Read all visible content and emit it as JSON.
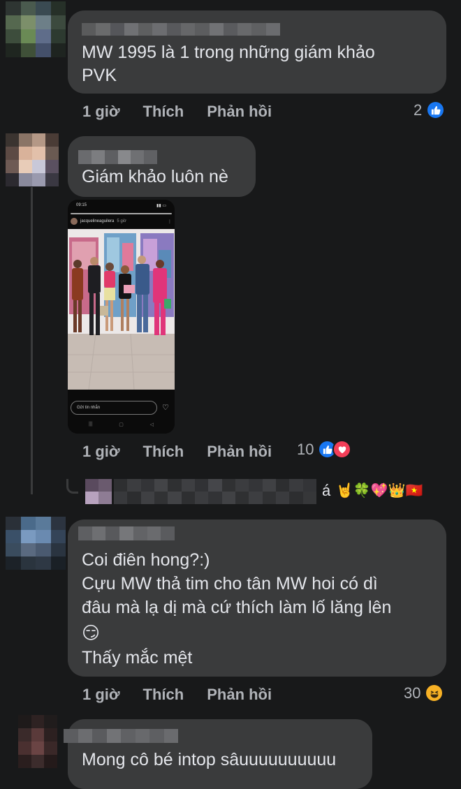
{
  "comments": [
    {
      "text_lines": [
        "MW 1995 là 1 trong những giám khảo",
        "PVK"
      ],
      "time": "1 giờ",
      "like_label": "Thích",
      "reply_label": "Phản hồi",
      "reaction_count": "2",
      "reactions": [
        "like"
      ]
    },
    {
      "text_lines": [
        "Giám khảo luôn nè"
      ],
      "time": "1 giờ",
      "like_label": "Thích",
      "reply_label": "Phản hồi",
      "reaction_count": "10",
      "reactions": [
        "like",
        "love"
      ],
      "attachment": {
        "status_time": "09:15",
        "username": "jacquelineaguilera",
        "post_age": "5 giờ",
        "message_placeholder": "Gửi tin nhắn"
      }
    },
    {
      "text_lines": [
        "Coi điên hong?:)",
        "Cựu MW thả tim cho tân MW hoi có dì",
        "đâu mà lạ dị mà cứ thích làm lố lăng lên",
        "😏",
        "Thấy mắc mệt"
      ],
      "time": "1 giờ",
      "like_label": "Thích",
      "reply_label": "Phản hồi",
      "reaction_count": "30",
      "reactions": [
        "haha"
      ]
    },
    {
      "text_lines": [
        "Mong cô bé intop sâuuuuuuuuuu"
      ]
    }
  ],
  "reply_preview": {
    "suffix": "á",
    "emojis": "🤘🍀💖👑🇻🇳"
  },
  "colors": {
    "background": "#18191a",
    "bubble": "#3a3b3c",
    "text": "#e4e6eb",
    "secondary": "#b0b3b8",
    "like_blue": "#1877f2",
    "love_red": "#f33e58",
    "haha_yellow": "#f7b125"
  }
}
